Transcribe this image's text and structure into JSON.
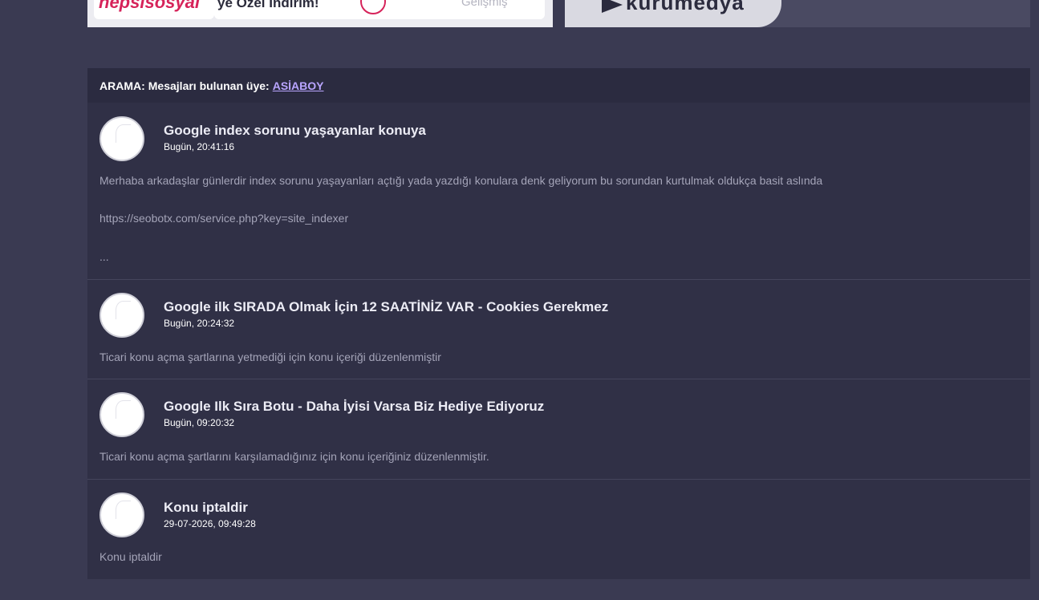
{
  "banners": {
    "left": {
      "brand": "hepsisosyal",
      "promo": "ye Özel İndirim!",
      "faded": "Gelişmiş"
    },
    "right": {
      "logo": "kurumedya"
    }
  },
  "search": {
    "prefix": "ARAMA:",
    "label": "Mesajları bulunan üye:",
    "user": "ASİABOY"
  },
  "posts": [
    {
      "title": "Google index sorunu yaşayanlar konuya",
      "date": "Bugün, 20:41:16",
      "body_lines": [
        "Merhaba arkadaşlar günlerdir index sorunu yaşayanları açtığı yada yazdığı konulara denk geliyorum bu sorundan kurtulmak oldukça basit aslında",
        "https://seobotx.com/service.php?key=site_indexer",
        "..."
      ]
    },
    {
      "title": "Google ilk SIRADA Olmak İçin 12 SAATİNİZ VAR - Cookies Gerekmez",
      "date": "Bugün, 20:24:32",
      "body_lines": [
        "Ticari konu açma şartlarına yetmediği için konu içeriği düzenlenmiştir"
      ]
    },
    {
      "title": "Google Ilk Sıra Botu - Daha İyisi Varsa Biz Hediye Ediyoruz",
      "date": "Bugün, 09:20:32",
      "body_lines": [
        "Ticari konu açma şartlarını karşılamadığınız için konu içeriğiniz düzenlenmiştir."
      ]
    },
    {
      "title": "Konu iptaldir",
      "date": "29-07-2026, 09:49:28",
      "body_lines": [
        "Konu iptaldir"
      ]
    }
  ]
}
